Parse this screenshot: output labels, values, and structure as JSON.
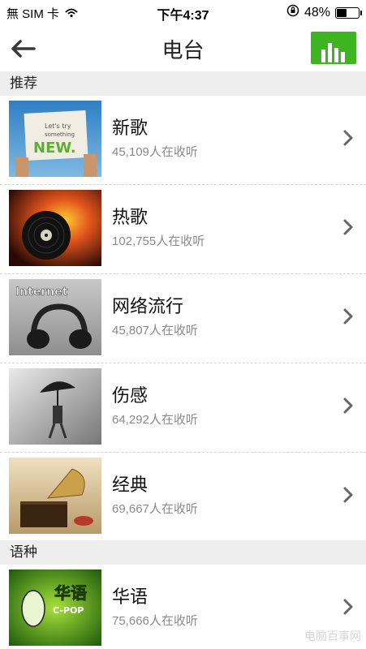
{
  "status_bar": {
    "carrier": "無 SIM 卡",
    "time": "下午4:37",
    "battery_percent": "48%",
    "battery_level": 0.48
  },
  "nav": {
    "title": "电台"
  },
  "sections": [
    {
      "header": "推荐",
      "items": [
        {
          "title": "新歌",
          "listeners": "45,109人在收听",
          "thumb_text": "Let's try something NEW."
        },
        {
          "title": "热歌",
          "listeners": "102,755人在收听",
          "thumb_text": ""
        },
        {
          "title": "网络流行",
          "listeners": "45,807人在收听",
          "thumb_text": "Internet"
        },
        {
          "title": "伤感",
          "listeners": "64,292人在收听",
          "thumb_text": ""
        },
        {
          "title": "经典",
          "listeners": "69,667人在收听",
          "thumb_text": ""
        }
      ]
    },
    {
      "header": "语种",
      "items": [
        {
          "title": "华语",
          "listeners": "75,666人在收听",
          "thumb_text": "华语 C-POP"
        }
      ]
    }
  ],
  "watermark": "电脑百事网",
  "colors": {
    "accent_green": "#3cb521",
    "section_bg": "#eeeeee",
    "subtext": "#8a8a8a"
  }
}
